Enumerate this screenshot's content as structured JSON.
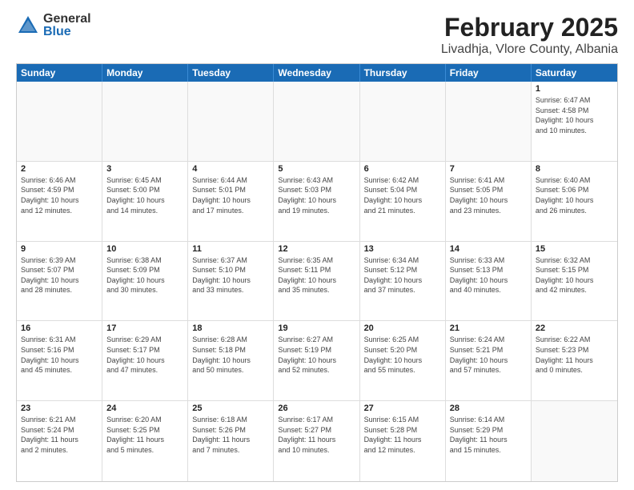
{
  "logo": {
    "general": "General",
    "blue": "Blue"
  },
  "title": "February 2025",
  "subtitle": "Livadhja, Vlore County, Albania",
  "header_days": [
    "Sunday",
    "Monday",
    "Tuesday",
    "Wednesday",
    "Thursday",
    "Friday",
    "Saturday"
  ],
  "weeks": [
    [
      {
        "day": "",
        "info": "",
        "empty": true
      },
      {
        "day": "",
        "info": "",
        "empty": true
      },
      {
        "day": "",
        "info": "",
        "empty": true
      },
      {
        "day": "",
        "info": "",
        "empty": true
      },
      {
        "day": "",
        "info": "",
        "empty": true
      },
      {
        "day": "",
        "info": "",
        "empty": true
      },
      {
        "day": "1",
        "info": "Sunrise: 6:47 AM\nSunset: 4:58 PM\nDaylight: 10 hours\nand 10 minutes.",
        "empty": false
      }
    ],
    [
      {
        "day": "2",
        "info": "Sunrise: 6:46 AM\nSunset: 4:59 PM\nDaylight: 10 hours\nand 12 minutes.",
        "empty": false
      },
      {
        "day": "3",
        "info": "Sunrise: 6:45 AM\nSunset: 5:00 PM\nDaylight: 10 hours\nand 14 minutes.",
        "empty": false
      },
      {
        "day": "4",
        "info": "Sunrise: 6:44 AM\nSunset: 5:01 PM\nDaylight: 10 hours\nand 17 minutes.",
        "empty": false
      },
      {
        "day": "5",
        "info": "Sunrise: 6:43 AM\nSunset: 5:03 PM\nDaylight: 10 hours\nand 19 minutes.",
        "empty": false
      },
      {
        "day": "6",
        "info": "Sunrise: 6:42 AM\nSunset: 5:04 PM\nDaylight: 10 hours\nand 21 minutes.",
        "empty": false
      },
      {
        "day": "7",
        "info": "Sunrise: 6:41 AM\nSunset: 5:05 PM\nDaylight: 10 hours\nand 23 minutes.",
        "empty": false
      },
      {
        "day": "8",
        "info": "Sunrise: 6:40 AM\nSunset: 5:06 PM\nDaylight: 10 hours\nand 26 minutes.",
        "empty": false
      }
    ],
    [
      {
        "day": "9",
        "info": "Sunrise: 6:39 AM\nSunset: 5:07 PM\nDaylight: 10 hours\nand 28 minutes.",
        "empty": false
      },
      {
        "day": "10",
        "info": "Sunrise: 6:38 AM\nSunset: 5:09 PM\nDaylight: 10 hours\nand 30 minutes.",
        "empty": false
      },
      {
        "day": "11",
        "info": "Sunrise: 6:37 AM\nSunset: 5:10 PM\nDaylight: 10 hours\nand 33 minutes.",
        "empty": false
      },
      {
        "day": "12",
        "info": "Sunrise: 6:35 AM\nSunset: 5:11 PM\nDaylight: 10 hours\nand 35 minutes.",
        "empty": false
      },
      {
        "day": "13",
        "info": "Sunrise: 6:34 AM\nSunset: 5:12 PM\nDaylight: 10 hours\nand 37 minutes.",
        "empty": false
      },
      {
        "day": "14",
        "info": "Sunrise: 6:33 AM\nSunset: 5:13 PM\nDaylight: 10 hours\nand 40 minutes.",
        "empty": false
      },
      {
        "day": "15",
        "info": "Sunrise: 6:32 AM\nSunset: 5:15 PM\nDaylight: 10 hours\nand 42 minutes.",
        "empty": false
      }
    ],
    [
      {
        "day": "16",
        "info": "Sunrise: 6:31 AM\nSunset: 5:16 PM\nDaylight: 10 hours\nand 45 minutes.",
        "empty": false
      },
      {
        "day": "17",
        "info": "Sunrise: 6:29 AM\nSunset: 5:17 PM\nDaylight: 10 hours\nand 47 minutes.",
        "empty": false
      },
      {
        "day": "18",
        "info": "Sunrise: 6:28 AM\nSunset: 5:18 PM\nDaylight: 10 hours\nand 50 minutes.",
        "empty": false
      },
      {
        "day": "19",
        "info": "Sunrise: 6:27 AM\nSunset: 5:19 PM\nDaylight: 10 hours\nand 52 minutes.",
        "empty": false
      },
      {
        "day": "20",
        "info": "Sunrise: 6:25 AM\nSunset: 5:20 PM\nDaylight: 10 hours\nand 55 minutes.",
        "empty": false
      },
      {
        "day": "21",
        "info": "Sunrise: 6:24 AM\nSunset: 5:21 PM\nDaylight: 10 hours\nand 57 minutes.",
        "empty": false
      },
      {
        "day": "22",
        "info": "Sunrise: 6:22 AM\nSunset: 5:23 PM\nDaylight: 11 hours\nand 0 minutes.",
        "empty": false
      }
    ],
    [
      {
        "day": "23",
        "info": "Sunrise: 6:21 AM\nSunset: 5:24 PM\nDaylight: 11 hours\nand 2 minutes.",
        "empty": false
      },
      {
        "day": "24",
        "info": "Sunrise: 6:20 AM\nSunset: 5:25 PM\nDaylight: 11 hours\nand 5 minutes.",
        "empty": false
      },
      {
        "day": "25",
        "info": "Sunrise: 6:18 AM\nSunset: 5:26 PM\nDaylight: 11 hours\nand 7 minutes.",
        "empty": false
      },
      {
        "day": "26",
        "info": "Sunrise: 6:17 AM\nSunset: 5:27 PM\nDaylight: 11 hours\nand 10 minutes.",
        "empty": false
      },
      {
        "day": "27",
        "info": "Sunrise: 6:15 AM\nSunset: 5:28 PM\nDaylight: 11 hours\nand 12 minutes.",
        "empty": false
      },
      {
        "day": "28",
        "info": "Sunrise: 6:14 AM\nSunset: 5:29 PM\nDaylight: 11 hours\nand 15 minutes.",
        "empty": false
      },
      {
        "day": "",
        "info": "",
        "empty": true
      }
    ]
  ]
}
